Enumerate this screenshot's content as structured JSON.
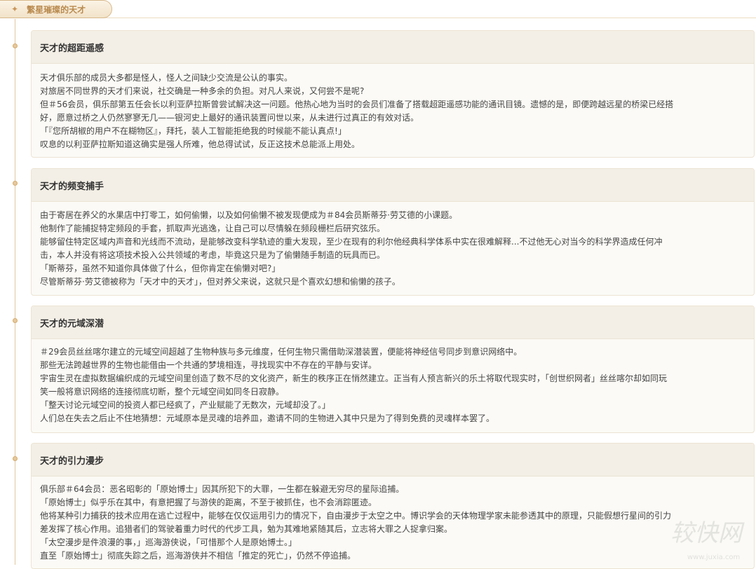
{
  "tab": {
    "label": "繁星璀璨的天才"
  },
  "cards": [
    {
      "title": "天才的超距遥感",
      "lines": [
        "天才俱乐部的成员大多都是怪人，怪人之间缺少交流是公认的事实。",
        "对旅居不同世界的天才们来说，社交确是一种多余的负担。对凡人来说，又何尝不是呢?",
        "但＃56会员，俱乐部第五任会长以利亚萨拉斯曾尝试解决这一问题。他热心地为当时的会员们准备了搭载超距遥感功能的通讯目镜。遗憾的是，即便跨越远星的桥梁已经搭",
        "好，愿意过桥之人仍然寥寥无几——银河史上最好的通讯装置问世以来，从未进行过真正的有效对话。",
        "「『您所胡椒的用户不在糊物区』，拜托，装人工智能拒绝我的时候能不能认真点!」",
        "叹息的以利亚萨拉斯知道这确实是强人所难，他总得试试，反正这技术总能派上用处。"
      ]
    },
    {
      "title": "天才的频变捕手",
      "lines": [
        "由于寄居在养父的水果店中打零工，如何偷懒，以及如何偷懒不被发现便成为＃84会员斯蒂芬·劳艾德的小课题。",
        "他制作了能捕捉特定频段的手套，抓取声光逃逸，让自己可以尽情躲在频段栅栏后研究弦乐。",
        "能够留住特定区域内声音和光线而不流动，是能够改变科学轨迹的重大发现，至少在现有的利尔他经典科学体系中实在很难解释...不过他无心对当今的科学界造成任何冲",
        "击，本人并没有将这项技术投入公共领域的考虑，毕竟这只是为了偷懒随手制造的玩具而已。",
        "「斯蒂芬，虽然不知道你具体做了什么，但你肯定在偷懒对吧?」",
        "尽管斯蒂芬·劳艾德被称为「天才中的天才」，但对养父来说，这就只是个喜欢幻想和偷懒的孩子。"
      ]
    },
    {
      "title": "天才的元域深潜",
      "lines": [
        "＃29会员丝丝喀尔建立的元域空间超越了生物种族与多元维度，任何生物只需借助深潜装置，便能将神经信号同步到意识网络中。",
        "那些无法跨越世界的生物也能借由一个共通的梦境相连，寻找现实中不存在的平静与安详。",
        "宇宙生灵在虚拟数据编织成的元域空间里创造了数不尽的文化资产，新生的秩序正在悄然建立。正当有人预言新兴的乐土将取代现实时，「创世织网者」丝丝喀尔却如同玩",
        "笑一般将意识网络的连接彻底切断，整个元域空间如同冬日寂静。",
        "「整天讨论元域空间的投资人都已经疯了，产业赋能了无数次，元域却没了。」",
        "人们总在失去之后止不住地猜想：元域原本是灵魂的培养皿，邀请不同的生物进入其中只是为了得到免费的灵魂样本罢了。"
      ]
    },
    {
      "title": "天才的引力漫步",
      "lines": [
        "俱乐部＃64会员：恶名昭彰的「原始博士」因其所犯下的大罪，一生都在躲避无穷尽的星际追捕。",
        "「原始博士」似乎乐在其中，有意把握了与游侠的距离，不至于被抓住，也不会消踪匿迹。",
        "他将某种引力捕获的技术应用在逃亡过程中，能够在仅仅运用引力的情况下，自由漫步于太空之中。博识学会的天体物理学家未能参透其中的原理，只能假想行星间的引力",
        "差发挥了核心作用。追猎者们的驾驶着重力时代的代步工具，勉为其难地紧随其后，立志将大罪之人捉拿归案。",
        "「太空漫步是件浪漫的事，」巡海游侠说，「可惜那个人是原始博士。」",
        "直至「原始博士」彻底失踪之后，巡海游侠并不相信「推定的死亡」，仍然不停追捕。"
      ]
    }
  ],
  "watermark": {
    "text": "较快网",
    "url_text": "www.juxia.com"
  }
}
